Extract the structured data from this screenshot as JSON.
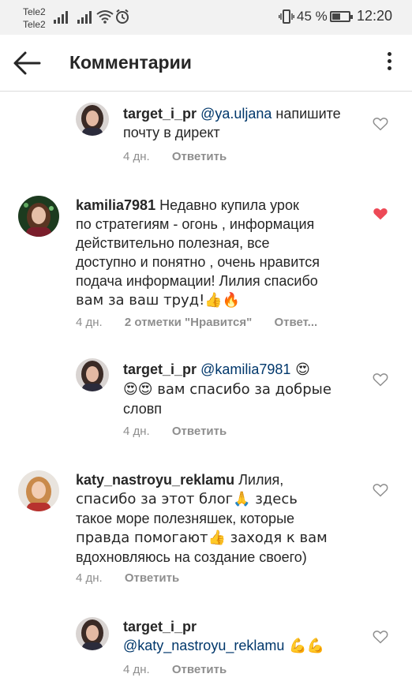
{
  "status": {
    "carrier1": "Tele2",
    "carrier2": "Tele2",
    "battery": "45 %",
    "time": "12:20"
  },
  "header": {
    "title": "Комментарии"
  },
  "comments": [
    {
      "username": "target_i_pr",
      "mention": "@ya.uljana",
      "line1": " напишите",
      "line2": "почту  в директ",
      "time": "4 дн.",
      "reply": "Ответить",
      "liked": false
    },
    {
      "username": "kamilia7981",
      "line1": " Недавно купила урок",
      "line2": "по стратегиям - огонь , информация",
      "line3": "действительно полезная, все",
      "line4": "доступно и понятно , очень нравится",
      "line5": "подача информации! Лилия спасибо",
      "line6": "вам за ваш труд!👍🔥",
      "time": "4 дн.",
      "likes": "2 отметки \"Нравится\"",
      "reply": "Ответ...",
      "liked": true
    },
    {
      "username": "target_i_pr",
      "mention": "@kamilia7981",
      "line1_emoji": " 😍",
      "line2": "😍😍 вам спасибо за добрые",
      "line3": "словп",
      "time": "4 дн.",
      "reply": "Ответить",
      "liked": false
    },
    {
      "username": "katy_nastroyu_reklamu",
      "line1": " Лилия,",
      "line2": "спасибо за этот блог🙏 здесь",
      "line3": "такое море полезняшек, которые",
      "line4": "правда помогают👍 заходя к вам",
      "line5": "вдохновляюсь на создание своего)",
      "time": "4 дн.",
      "reply": "Ответить",
      "liked": false
    },
    {
      "username": "target_i_pr",
      "mention": "@katy_nastroyu_reklamu",
      "line2_emoji": " 💪💪",
      "time": "4 дн.",
      "reply": "Ответить",
      "liked": false
    }
  ],
  "colors": {
    "heart_liked": "#ed4956",
    "mention": "#00376b",
    "meta": "#8e8e8e"
  }
}
